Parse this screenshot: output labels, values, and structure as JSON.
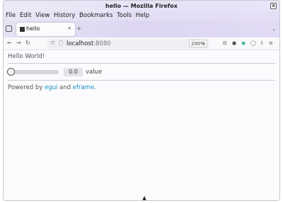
{
  "window": {
    "title": "hello — Mozilla Firefox",
    "close_glyph": "×"
  },
  "menu": [
    "File",
    "Edit",
    "View",
    "History",
    "Bookmarks",
    "Tools",
    "Help"
  ],
  "tab": {
    "title": "hello",
    "close_glyph": "×",
    "new_tab_glyph": "+",
    "list_all_glyph": "⌄"
  },
  "nav": {
    "back_glyph": "←",
    "forward_glyph": "→",
    "reload_glyph": "↻",
    "url_host": "localhost",
    "url_port": ":8080",
    "zoom": "200%",
    "star_glyph": "☆"
  },
  "toolbar_icons": [
    {
      "name": "pocket-icon",
      "glyph": "⊟"
    },
    {
      "name": "github-icon",
      "glyph": "●"
    },
    {
      "name": "extension-icon",
      "glyph": "◉"
    },
    {
      "name": "account-icon",
      "glyph": "◯"
    },
    {
      "name": "downloads-icon",
      "glyph": "⇩"
    },
    {
      "name": "menu-icon",
      "glyph": "≡"
    }
  ],
  "app": {
    "heading": "Hello World!",
    "slider": {
      "value": 0.0,
      "display": "0.0",
      "label": "value"
    },
    "footer": {
      "prefix": "Powered by ",
      "link1": "egui",
      "middle": " and ",
      "link2": "eframe",
      "suffix": "."
    }
  },
  "colors": {
    "link": "#1a8ec4",
    "titlebar_tint": "#e7e2f6"
  }
}
